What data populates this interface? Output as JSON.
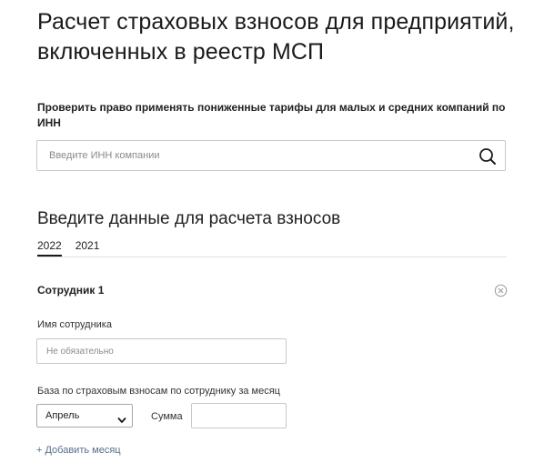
{
  "page": {
    "title": "Расчет страховых взносов для предприятий, включенных в реестр МСП"
  },
  "inn_check": {
    "description": "Проверить право применять пониженные тарифы для малых и средних компаний по ИНН",
    "placeholder": "Введите ИНН компании",
    "value": "",
    "search_icon": "search-icon"
  },
  "calculation": {
    "section_title": "Введите данные для расчета взносов",
    "tabs": [
      {
        "label": "2022",
        "active": true
      },
      {
        "label": "2021",
        "active": false
      }
    ]
  },
  "employee": {
    "title": "Сотрудник 1",
    "remove_icon": "close-circle-icon",
    "name_label": "Имя сотрудника",
    "name_placeholder": "Не обязательно",
    "name_value": "",
    "base_label": "База по страховым взносам по сотруднику за месяц",
    "month_selected": "Апрель",
    "sum_label": "Сумма",
    "sum_value": "",
    "add_month_label": "+ Добавить месяц"
  },
  "colors": {
    "text": "#222222",
    "border": "#c8c8c8",
    "link": "#5a6e8c",
    "background": "#ffffff"
  }
}
